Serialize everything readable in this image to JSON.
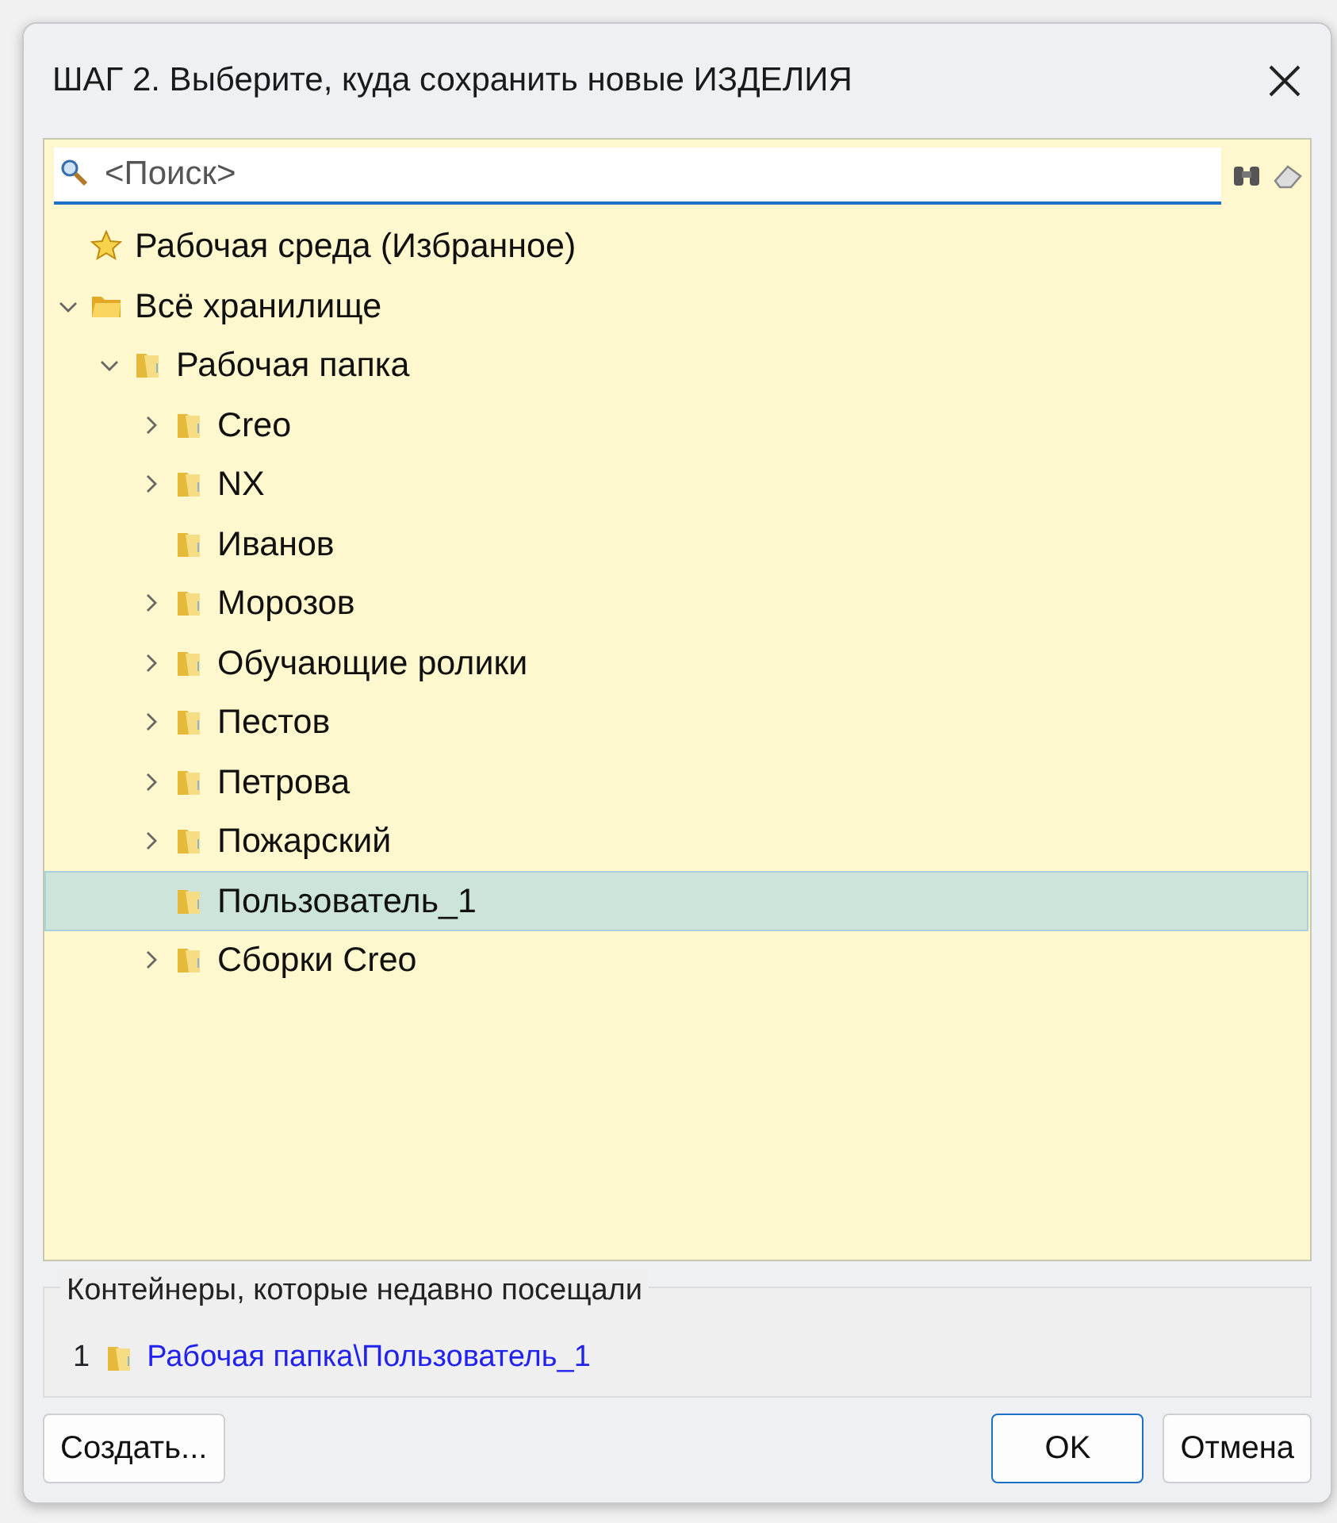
{
  "window": {
    "title": "ШАГ 2. Выберите, куда сохранить новые ИЗДЕЛИЯ"
  },
  "search": {
    "placeholder": "<Поиск>"
  },
  "tree": [
    {
      "label": "Рабочая среда (Избранное)",
      "kind": "favorite",
      "has_children": false,
      "selected": false
    },
    {
      "label": "Всё хранилище",
      "kind": "storage",
      "has_children": true,
      "expanded": true,
      "selected": false,
      "children": [
        {
          "label": "Рабочая папка",
          "kind": "folder",
          "has_children": true,
          "expanded": true,
          "selected": false,
          "children": [
            {
              "label": "Creo",
              "kind": "folder",
              "has_children": true,
              "expanded": false,
              "selected": false
            },
            {
              "label": "NX",
              "kind": "folder",
              "has_children": true,
              "expanded": false,
              "selected": false
            },
            {
              "label": "Иванов",
              "kind": "folder",
              "has_children": false,
              "selected": false
            },
            {
              "label": "Морозов",
              "kind": "folder",
              "has_children": true,
              "expanded": false,
              "selected": false
            },
            {
              "label": "Обучающие ролики",
              "kind": "folder",
              "has_children": true,
              "expanded": false,
              "selected": false
            },
            {
              "label": "Пестов",
              "kind": "folder",
              "has_children": true,
              "expanded": false,
              "selected": false
            },
            {
              "label": "Петрова",
              "kind": "folder",
              "has_children": true,
              "expanded": false,
              "selected": false
            },
            {
              "label": "Пожарский",
              "kind": "folder",
              "has_children": true,
              "expanded": false,
              "selected": false
            },
            {
              "label": "Пользователь_1",
              "kind": "folder",
              "has_children": false,
              "selected": true
            },
            {
              "label": "Сборки Creo",
              "kind": "folder",
              "has_children": true,
              "expanded": false,
              "selected": false
            }
          ]
        }
      ]
    }
  ],
  "recent": {
    "title": "Контейнеры, которые недавно посещали",
    "items": [
      {
        "number": "1",
        "path": "Рабочая папка\\Пользователь_1"
      }
    ]
  },
  "buttons": {
    "left": [
      {
        "label": "Создать...",
        "default": false
      }
    ],
    "right": [
      {
        "label": "OK",
        "default": true
      },
      {
        "label": "Отмена",
        "default": false
      }
    ]
  }
}
